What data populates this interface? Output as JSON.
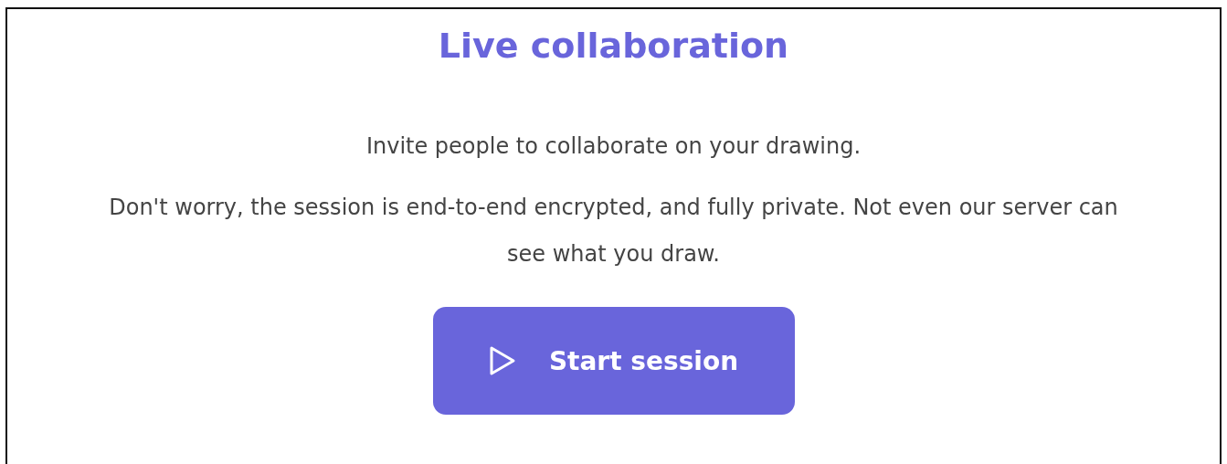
{
  "dialog": {
    "title": "Live collaboration",
    "paragraphs": [
      "Invite people to collaborate on your drawing.",
      "Don't worry, the session is end-to-end encrypted, and fully private. Not even our server can see what you draw."
    ],
    "button": {
      "label": "Start session"
    }
  }
}
